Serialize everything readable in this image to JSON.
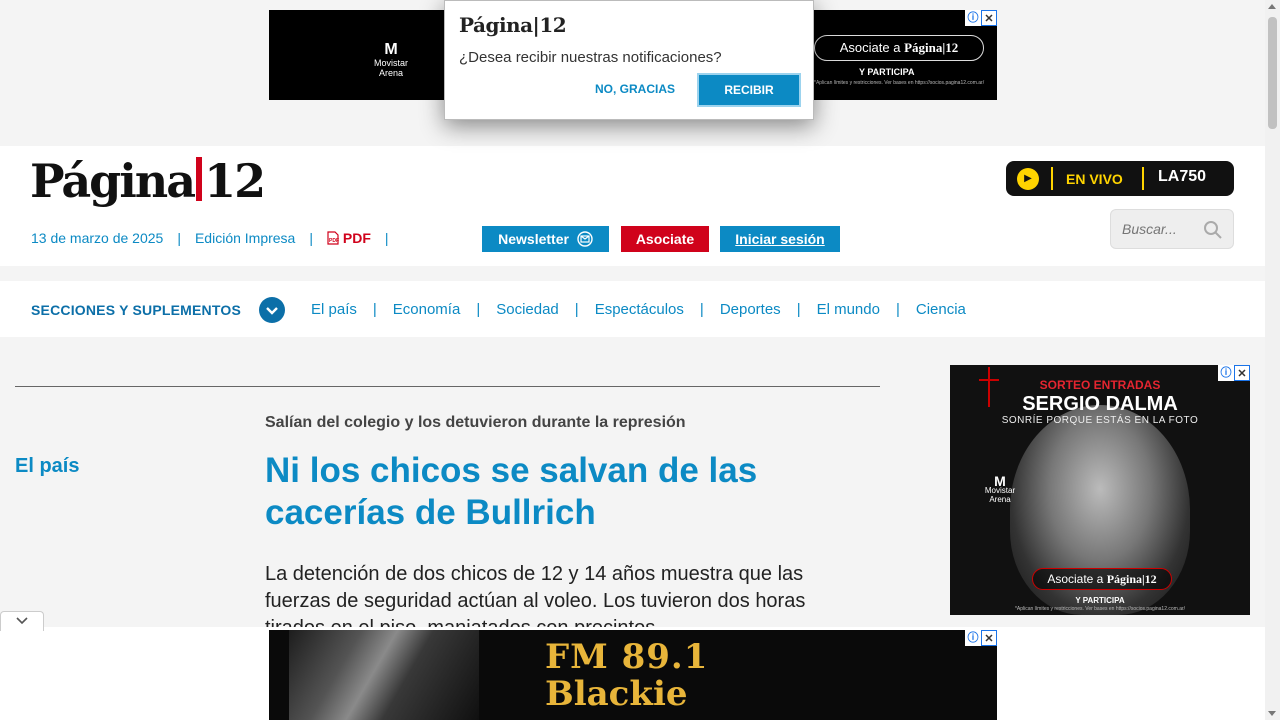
{
  "dialog": {
    "logo": "Página|12",
    "question": "¿Desea recibir nuestras notificaciones?",
    "decline": "NO, GRACIAS",
    "accept": "RECIBIR"
  },
  "ads": {
    "top": {
      "brand": "Movistar Arena",
      "brand_mark": "M",
      "button_prefix": "Asociate a ",
      "button_brand": "Página|12",
      "sub": "Y PARTICIPA",
      "fine_print": "*Aplican límites y restricciones. Ver bases en https://socios.pagina12.com.ar/"
    },
    "right": {
      "sorteo": "SORTEO ENTRADAS",
      "artist": "SERGIO DALMA",
      "tagline": "SONRÍE PORQUE ESTÁS EN LA FOTO",
      "brand": "Movistar Arena",
      "brand_mark": "M",
      "button_prefix": "Asociate a ",
      "button_brand": "Página|12",
      "sub": "Y PARTICIPA",
      "fine_print": "*Aplican límites y restricciones. Ver bases en https://socios.pagina12.com.ar/"
    },
    "bottom": {
      "line1": "FM 89.1",
      "line2": "Blackie"
    },
    "info_icon": "ⓘ",
    "close_icon": "✕"
  },
  "header": {
    "logo_left": "Página",
    "logo_right": "12",
    "date": "13 de marzo de 2025",
    "edition": "Edición Impresa",
    "pdf": "PDF",
    "newsletter": "Newsletter",
    "asociate": "Asociate",
    "login": "Iniciar sesión",
    "live": "EN VIVO",
    "radio": "LA750",
    "search_placeholder": "Buscar..."
  },
  "nav": {
    "title": "SECCIONES Y SUPLEMENTOS",
    "links": [
      "El país",
      "Economía",
      "Sociedad",
      "Espectáculos",
      "Deportes",
      "El mundo",
      "Ciencia"
    ]
  },
  "article": {
    "section": "El país",
    "kicker": "Salían del colegio y los detuvieron durante la represión",
    "headline": "Ni los chicos se salvan de las cacerías de Bullrich",
    "lead": "La detención de dos chicos de 12 y 14 años muestra que las fuerzas de seguridad actúan al voleo. Los tuvieron dos horas tirados en el piso, maniatados con precintos."
  },
  "colors": {
    "brand_blue": "#0c8ac4",
    "brand_red": "#d0021b",
    "live_yellow": "#ffd400"
  }
}
